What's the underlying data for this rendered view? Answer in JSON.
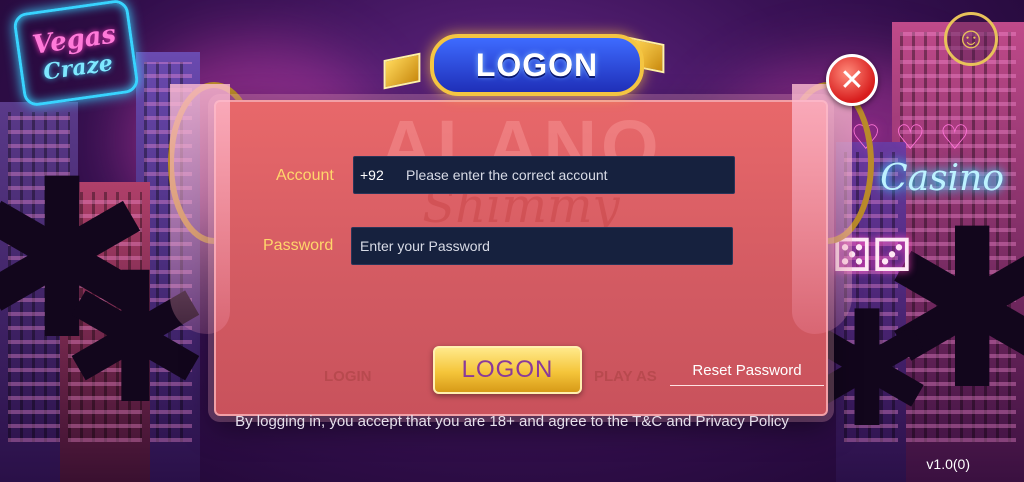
{
  "header": {
    "title": "LOGON",
    "close_icon": "close-icon",
    "avatar_icon": "face-icon"
  },
  "background": {
    "vegas_sign_line1": "Vegas",
    "vegas_sign_line2": "Craze",
    "casino_sign": "Casino",
    "watermark": "ALANO",
    "watermark_sub": "Shimmy"
  },
  "form": {
    "account_label": "Account",
    "account_prefix": "+92",
    "account_placeholder": "Please enter the correct account",
    "account_value": "",
    "password_label": "Password",
    "password_placeholder": "Enter your Password",
    "password_value": ""
  },
  "actions": {
    "logon_label": "LOGON",
    "reset_password_label": "Reset Password",
    "ghost_login": "LOGIN",
    "ghost_play": "PLAY AS"
  },
  "footer": {
    "terms": "By logging in, you accept that you are 18+ and agree to the T&C and Privacy Policy",
    "version": "v1.0(0)"
  },
  "colors": {
    "panel": "#d95e64",
    "label": "#ffd66b",
    "field_bg": "#16213e",
    "button": "#f5c53a",
    "title_badge": "#2a45d8"
  }
}
